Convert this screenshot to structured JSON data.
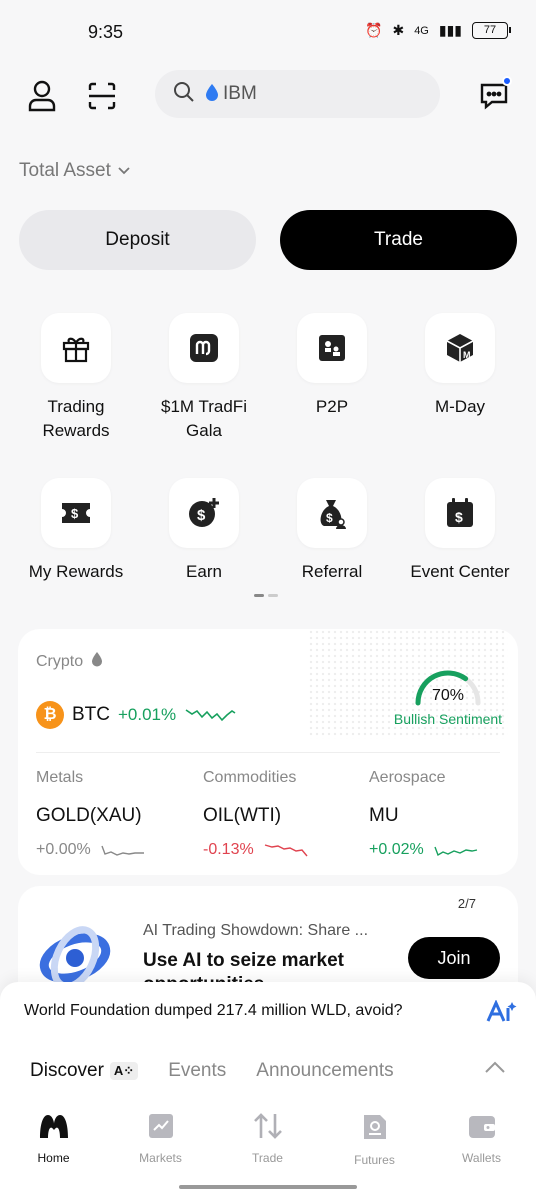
{
  "status_bar": {
    "time": "9:35",
    "battery": "77",
    "network": "4G"
  },
  "top_bar": {
    "search_placeholder": "IBM"
  },
  "total_asset": {
    "label": "Total Asset"
  },
  "actions": {
    "deposit": "Deposit",
    "trade": "Trade"
  },
  "quick_actions": [
    {
      "label": "Trading Rewards",
      "icon": "gift-icon"
    },
    {
      "label": "$1M TradFi Gala",
      "icon": "m-logo-icon"
    },
    {
      "label": "P2P",
      "icon": "p2p-icon"
    },
    {
      "label": "M-Day",
      "icon": "box-icon"
    },
    {
      "label": "My Rewards",
      "icon": "ticket-icon"
    },
    {
      "label": "Earn",
      "icon": "earn-coin-icon"
    },
    {
      "label": "Referral",
      "icon": "money-bag-icon"
    },
    {
      "label": "Event Center",
      "icon": "calendar-icon"
    }
  ],
  "market": {
    "crypto_label": "Crypto",
    "btc": {
      "symbol": "BTC",
      "change": "+0.01%"
    },
    "sentiment": {
      "value": "70%",
      "value_fraction": 0.7,
      "label": "Bullish Sentiment"
    },
    "columns": [
      {
        "category": "Metals",
        "symbol": "GOLD(XAU)",
        "change": "+0.00%",
        "trend": "flat"
      },
      {
        "category": "Commodities",
        "symbol": "OIL(WTI)",
        "change": "-0.13%",
        "trend": "down"
      },
      {
        "category": "Aerospace",
        "symbol": "MU",
        "change": "+0.02%",
        "trend": "up"
      }
    ],
    "colors": {
      "up": "#17a05e",
      "down": "#e0434f",
      "flat": "#888888"
    }
  },
  "promo": {
    "counter": "2/7",
    "subtitle": "AI Trading Showdown: Share ...",
    "title": "Use AI to seize market opportunities",
    "join_label": "Join"
  },
  "bottom_sheet": {
    "news": "World Foundation dumped 217.4 million WLD, avoid?",
    "tabs": {
      "discover": "Discover",
      "events": "Events",
      "announcements": "Announcements"
    }
  },
  "nav": [
    {
      "label": "Home",
      "icon": "home-m-icon",
      "active": true
    },
    {
      "label": "Markets",
      "icon": "markets-icon",
      "active": false
    },
    {
      "label": "Trade",
      "icon": "trade-arrows-icon",
      "active": false
    },
    {
      "label": "Futures",
      "icon": "futures-icon",
      "active": false
    },
    {
      "label": "Wallets",
      "icon": "wallet-icon",
      "active": false
    }
  ]
}
